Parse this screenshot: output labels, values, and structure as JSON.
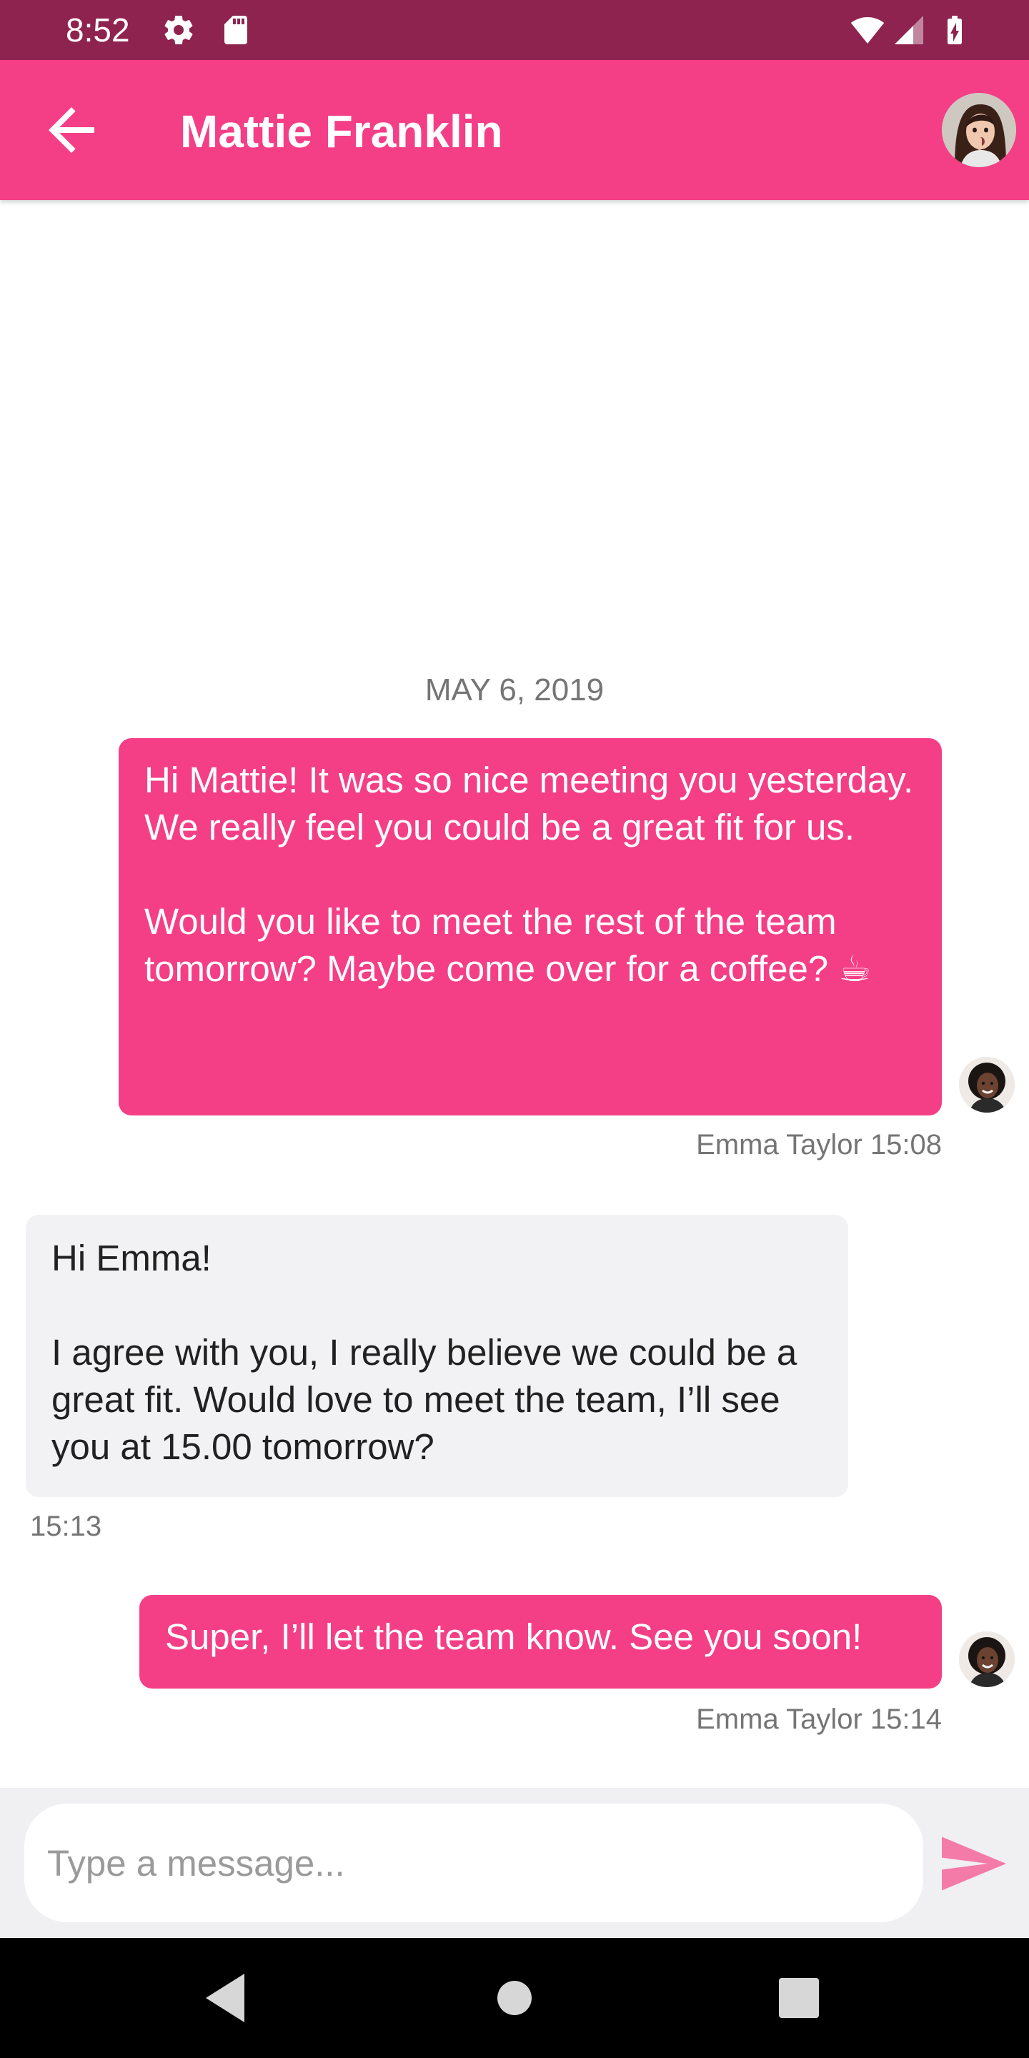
{
  "status_bar": {
    "time": "8:52",
    "icons": [
      "gear-icon",
      "sd-card-icon",
      "wifi-icon",
      "cellular-signal-icon",
      "battery-charging-icon"
    ]
  },
  "header": {
    "title": "Mattie Franklin",
    "back_icon": "arrow-left-icon",
    "avatar": "contact-avatar"
  },
  "conversation": {
    "date_separator": "MAY 6, 2019",
    "messages": [
      {
        "direction": "outgoing",
        "text": "Hi Mattie! It was so nice meeting you yesterday. We really feel you could be a great fit for us.\n\nWould you like to meet the rest of the team tomorrow? Maybe come over for a coffee? ☕",
        "meta": "Emma Taylor 15:08"
      },
      {
        "direction": "incoming",
        "text": "Hi Emma!\n\nI agree with you, I really believe we could be a great fit. Would love to meet the team, I’ll see you at 15.00 tomorrow?",
        "meta": "15:13"
      },
      {
        "direction": "outgoing",
        "text": "Super, I’ll let the team know. See you soon!",
        "meta": "Emma Taylor 15:14"
      }
    ]
  },
  "composer": {
    "placeholder": "Type a message...",
    "value": "",
    "send_icon": "send-icon"
  },
  "nav_bar": {
    "icons": [
      "back-triangle-icon",
      "home-circle-icon",
      "recents-square-icon"
    ]
  },
  "colors": {
    "accent": "#f43f87",
    "status_bar": "#8e2350",
    "incoming_bubble": "#f2f2f4",
    "meta_text": "#757575"
  }
}
